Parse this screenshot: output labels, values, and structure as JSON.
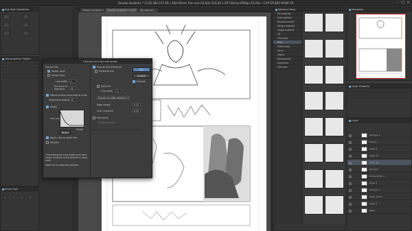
{
  "app": {
    "title": "Deadly Incidents * 11/32 (B4 257.00 x 364.00mm Trim size A4 Size 210.00 x 297.00mm 600dpi 25.0%) - CLIP STUDIO PAINT EX"
  },
  "panels": {
    "sub_tool": "Sub Tool: Operation",
    "tool_property": "Tool property: Object",
    "brush_size": "Brush Size",
    "materials": "Material: Pose",
    "navigator": "Navigator",
    "layer_property": "Layer Property",
    "layer": "Layer"
  },
  "tabs": [
    {
      "label": "Deadly Incidents *"
    },
    {
      "label": "Deadly Incidents * 11/32 *"
    },
    {
      "label": "3D_instrum..."
    }
  ],
  "dialog": {
    "title": "Convert to lines and tones",
    "section_extract": "Extract line",
    "raster_layer": "Raster layer",
    "vector_layer": "Vector layer",
    "line_width": "Line width",
    "line_width_val": "1",
    "accuracy": "Accuracy of detection",
    "accuracy_val": "50",
    "adjust_dpi": "Adjust outline according to scale",
    "emphasize": "Emphasize outline",
    "emphasize_val": "10",
    "depth": "Depth",
    "line_value": "Line value",
    "depth_label": "Depth",
    "reset": "Reset",
    "apply_color": "Apply ruby to outer line",
    "smooth": "Smooth",
    "extract_texture": "Extract line of texture",
    "posterize": "Posterize line",
    "reset_fill": "Reset fill",
    "line_width2": "Line width",
    "line_width2_val": "5",
    "process_edge": "Process as edge detection 1",
    "edge_length": "Edge length",
    "edge_length_val": "0.30",
    "line_curvature": "Line curvature",
    "line_curvature_val": "0.30",
    "tone_work": "Tone work",
    "posterize_tones": "Posterize tones",
    "note": "*Increasing the Line width level may cause variance in the texture or tone work.",
    "hint": "Hold Ctrl to view the preview.",
    "ok": "OK",
    "cancel": "Cancel",
    "preview": "Preview"
  },
  "materials": {
    "tree": [
      "All materials",
      "Color pattern",
      "Monochromatic",
      "Manga material",
      "Image material",
      "3D",
      "Character",
      "Pose",
      "Entire body",
      "Hand",
      "Object",
      "Background",
      "Download",
      "Favorites"
    ]
  },
  "layers": [
    {
      "name": "3D layer 2"
    },
    {
      "name": "Frame 1"
    },
    {
      "name": "Layer 9"
    },
    {
      "name": "Layer 13"
    },
    {
      "name": "Layer 14"
    },
    {
      "name": "3D layer"
    },
    {
      "name": "Frame folder 1"
    },
    {
      "name": "Layer 1"
    },
    {
      "name": "3D layer 1"
    },
    {
      "name": "Layer 3 Skin"
    },
    {
      "name": "Layer 5"
    },
    {
      "name": "Paper"
    }
  ]
}
